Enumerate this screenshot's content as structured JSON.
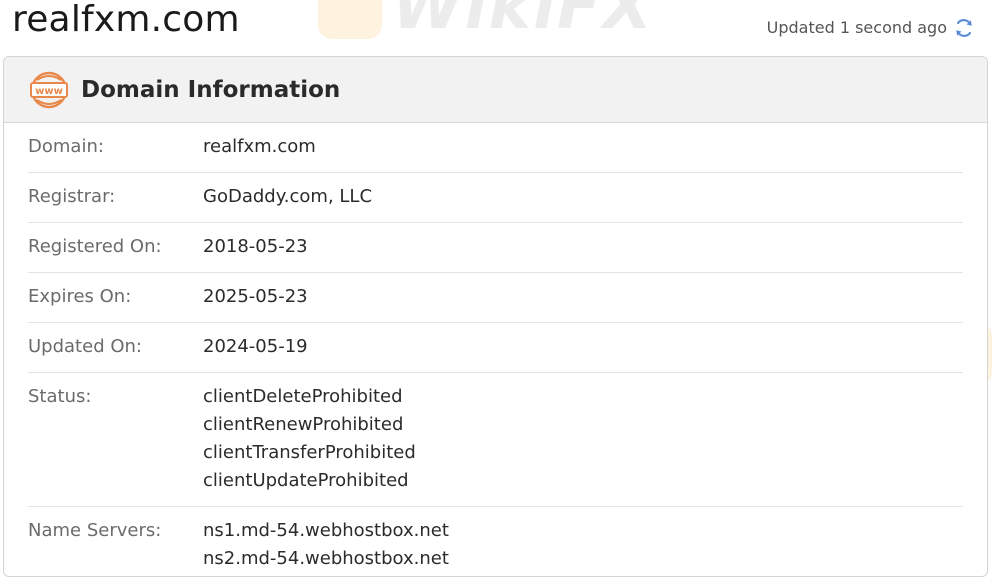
{
  "header": {
    "domain_title": "realfxm.com",
    "updated_text": "Updated 1 second ago",
    "refresh_icon": "refresh-icon"
  },
  "card": {
    "title": "Domain Information",
    "icon": "www-icon",
    "icon_text": "www",
    "accent_color": "#e8884a",
    "rows": [
      {
        "label": "Domain:",
        "values": [
          "realfxm.com"
        ]
      },
      {
        "label": "Registrar:",
        "values": [
          "GoDaddy.com, LLC"
        ]
      },
      {
        "label": "Registered On:",
        "values": [
          "2018-05-23"
        ]
      },
      {
        "label": "Expires On:",
        "values": [
          "2025-05-23"
        ]
      },
      {
        "label": "Updated On:",
        "values": [
          "2024-05-19"
        ]
      },
      {
        "label": "Status:",
        "values": [
          "clientDeleteProhibited",
          "clientRenewProhibited",
          "clientTransferProhibited",
          "clientUpdateProhibited"
        ]
      },
      {
        "label": "Name Servers:",
        "values": [
          "ns1.md-54.webhostbox.net",
          "ns2.md-54.webhostbox.net"
        ]
      }
    ]
  },
  "watermark": {
    "text": "WikiFX"
  }
}
